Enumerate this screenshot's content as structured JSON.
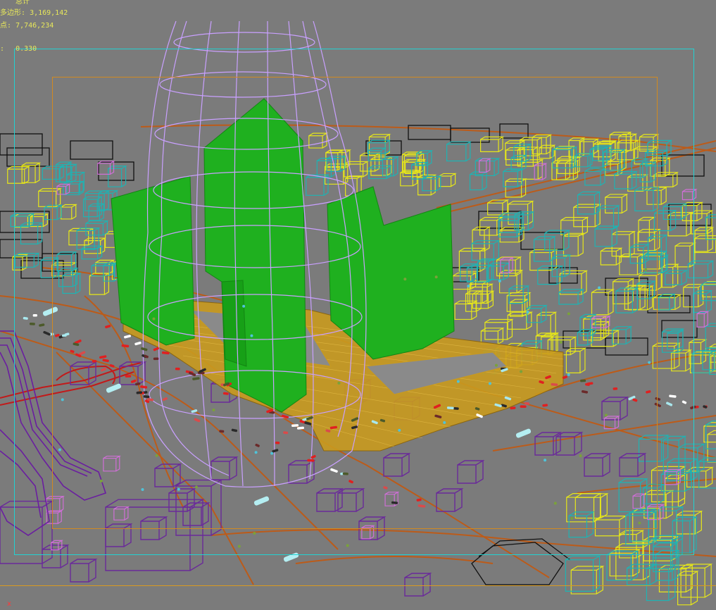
{
  "viewport": {
    "name": "3D viewport - perspective",
    "background": "#7b7b7b"
  },
  "stats": {
    "header": "总计",
    "polys_label": "多边形:",
    "polys_value": "3,169,142",
    "verts_label": "点:",
    "verts_value": "7,746,234",
    "fps_label": ":",
    "fps_value": "0.330"
  },
  "axis_label": "x",
  "colors": {
    "tower": "#1fb01f",
    "podium": "#c99a1e",
    "dome": "#c9a0ff",
    "roads": "#c05a14",
    "block_yellow": "#e6e61a",
    "block_cyan": "#1fb3b3",
    "block_black": "#111111",
    "block_purple": "#6a2a9a",
    "cars_red": "#e02020",
    "safe_frame": "#22d2d2",
    "title_frame": "#d18a20"
  }
}
